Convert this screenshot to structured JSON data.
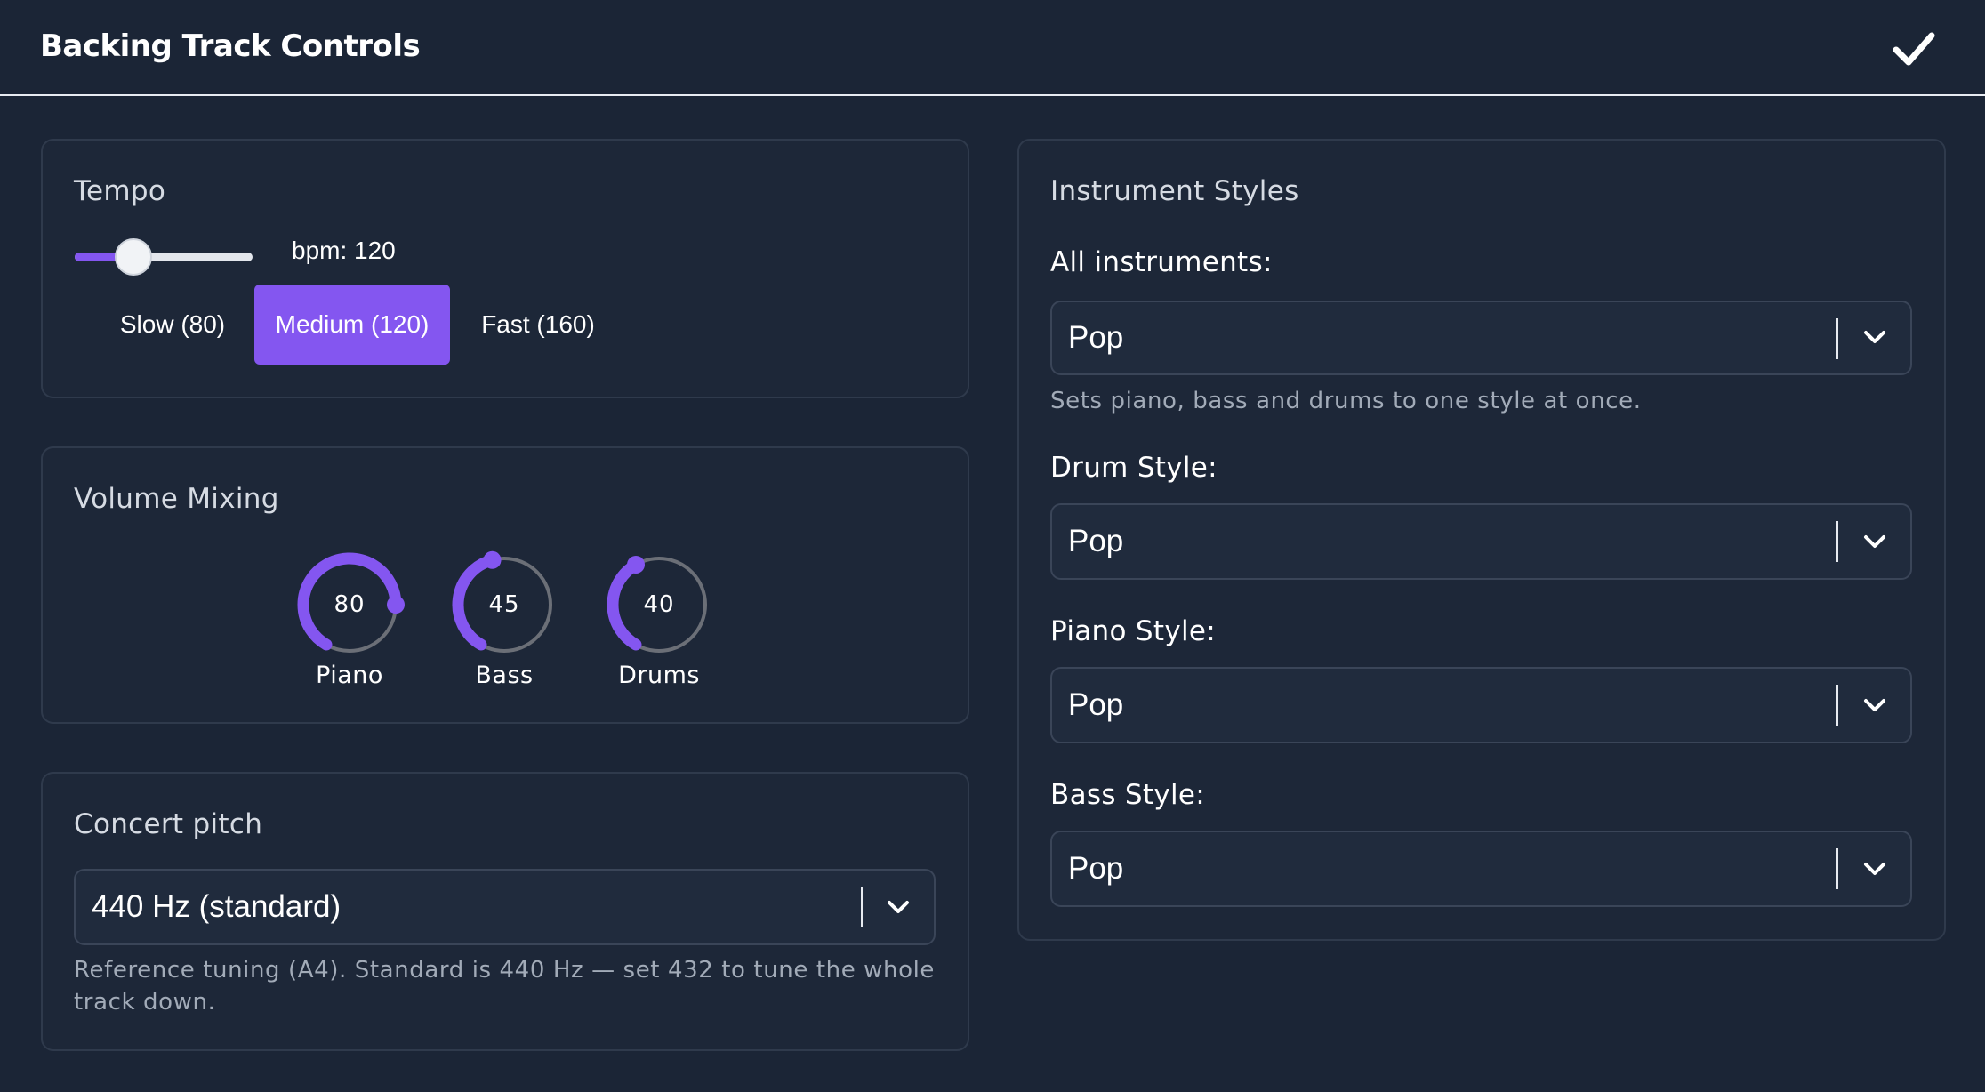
{
  "header": {
    "title": "Backing Track Controls",
    "confirm_icon": "check-icon"
  },
  "tempo": {
    "title": "Tempo",
    "bpm_label": "bpm: 120",
    "slider_fraction": 0.33,
    "buttons": [
      {
        "label": "Slow (80)",
        "active": false
      },
      {
        "label": "Medium (120)",
        "active": true
      },
      {
        "label": "Fast (160)",
        "active": false
      }
    ]
  },
  "volume": {
    "title": "Volume Mixing",
    "knobs": [
      {
        "label": "Piano",
        "value": "80",
        "level": 0.8
      },
      {
        "label": "Bass",
        "value": "45",
        "level": 0.45
      },
      {
        "label": "Drums",
        "value": "40",
        "level": 0.4
      }
    ]
  },
  "pitch": {
    "title": "Concert pitch",
    "selected": "440 Hz (standard)",
    "help_line1": "Reference tuning (A4). Standard is 440 Hz — set 432 to tune the whole",
    "help_line2": "track down."
  },
  "styles": {
    "title": "Instrument Styles",
    "all": {
      "label": "All instruments:",
      "selected": "Pop",
      "help": "Sets piano, bass and drums to one style at once."
    },
    "drum": {
      "label": "Drum Style:",
      "selected": "Pop"
    },
    "piano": {
      "label": "Piano Style:",
      "selected": "Pop"
    },
    "bass": {
      "label": "Bass Style:",
      "selected": "Pop"
    }
  },
  "colors": {
    "accent": "#8456f0",
    "background": "#1b2536",
    "knob_track": "#6b6f77"
  }
}
